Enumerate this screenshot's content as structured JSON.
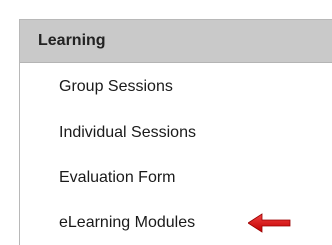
{
  "panel": {
    "title": "Learning",
    "items": [
      {
        "label": "Group Sessions"
      },
      {
        "label": "Individual Sessions"
      },
      {
        "label": "Evaluation Form"
      },
      {
        "label": "eLearning Modules",
        "highlighted": true
      }
    ]
  },
  "annotation": {
    "arrow_icon": "red-left-arrow-icon",
    "arrow_color": "#e01818"
  },
  "colors": {
    "header_bg": "#c9c9c9",
    "text": "#1a1a1a"
  }
}
